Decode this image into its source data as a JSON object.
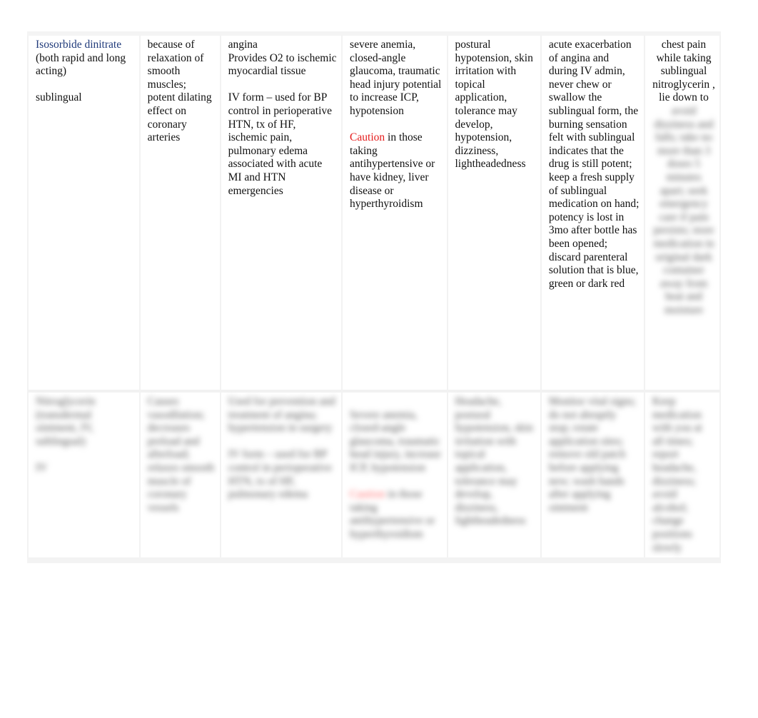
{
  "document": {
    "row_1": {
      "drug": {
        "name": "Isosorbide dinitrate",
        "type": "(both rapid and long acting)",
        "route": "sublingual"
      },
      "action": "because of relaxation of smooth muscles; potent dilating effect on coronary arteries",
      "indications": {
        "line_1": "angina",
        "line_2": "Provides O2 to ischemic myocardial tissue",
        "line_3": "IV form – used for BP control in perioperative HTN, tx of HF, ischemic pain, pulmonary edema associated with acute MI and HTN emergencies"
      },
      "contraindications": {
        "line_1": "severe anemia, closed-angle glaucoma, traumatic head injury potential to increase ICP, hypotension",
        "caution_label": "Caution",
        "caution_text": " in those taking antihypertensive or have kidney, liver disease or hyperthyroidism"
      },
      "adverse_effects": "postural hypotension, skin irritation with topical application, tolerance may develop, hypotension, dizziness, lightheadedness",
      "nursing_implications": "acute exacerbation of angina and during IV admin, never chew or swallow the sublingual form, the burning sensation felt with sublingual indicates that the drug is still potent; keep a fresh supply of sublingual medication on hand; potency is lost in 3mo after bottle has been opened; discard parenteral solution that is blue, green or dark red",
      "patient_teaching": {
        "visible": "chest pain while taking sublingual nitroglycerin , lie down to",
        "blurred": "avoid dizziness and falls; take no more than 3 doses 5 minutes apart; seek emergency care if pain persists; store medication in original dark container away from heat and moisture"
      }
    },
    "row_2": {
      "drug": {
        "name": "Nitroglycerin",
        "type": "(transdermal ointment, IV, sublingual)",
        "route": "IV"
      },
      "action": "Causes vasodilation; decreases preload and afterload; relaxes smooth muscle of coronary vessels",
      "indications": {
        "line_1": "Used for prevention and treatment of angina; hypertension in surgery",
        "line_2": "IV form – used for BP control in perioperative HTN, tx of HF, pulmonary edema"
      },
      "contraindications": {
        "line_1": "Severe anemia, closed-angle glaucoma, traumatic head injury, increase ICP, hypotension",
        "caution_label": "Caution",
        "caution_text": " in those taking antihypertensive or hyperthyroidism"
      },
      "adverse_effects": "Headache, postural hypotension, skin irritation with topical application, tolerance may develop, dizziness, lightheadedness",
      "nursing_implications": "Monitor vital signs; do not abruptly stop; rotate application sites; remove old patch before applying new; wash hands after applying ointment",
      "patient_teaching": "Keep medication with you at all times; report headache, dizziness; avoid alcohol; change positions slowly"
    }
  }
}
